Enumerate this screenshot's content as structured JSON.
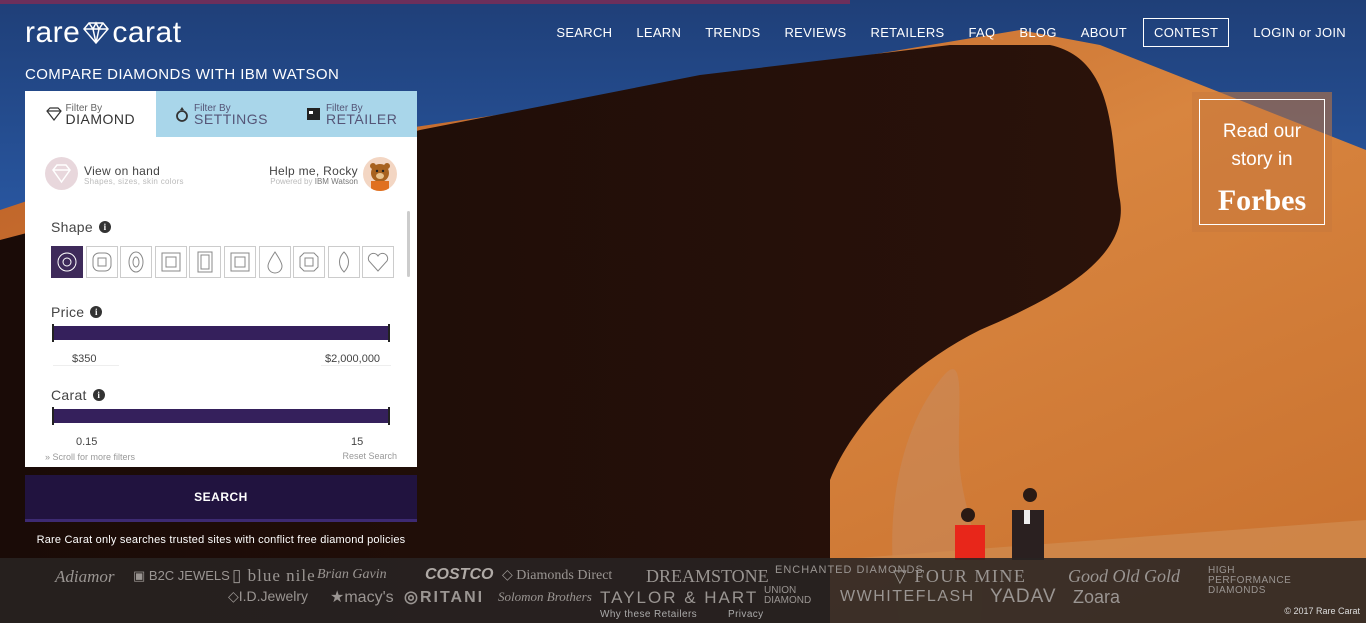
{
  "header": {
    "logo_text_left": "rare",
    "logo_text_right": "carat",
    "tagline": "COMPARE DIAMONDS WITH IBM WATSON",
    "nav": [
      "SEARCH",
      "LEARN",
      "TRENDS",
      "REVIEWS",
      "RETAILERS",
      "FAQ",
      "BLOG",
      "ABOUT",
      "CONTEST",
      "LOGIN or JOIN"
    ]
  },
  "forbes": {
    "line1": "Read our",
    "line2": "story in",
    "logo": "Forbes"
  },
  "panel": {
    "tabs": [
      {
        "small": "Filter By",
        "big": "DIAMOND",
        "icon": "diamond-icon"
      },
      {
        "small": "Filter By",
        "big": "SETTINGS",
        "icon": "ring-icon"
      },
      {
        "small": "Filter By",
        "big": "RETAILER",
        "icon": "store-icon"
      }
    ],
    "view_on_hand": {
      "title": "View on hand",
      "subtitle": "Shapes, sizes, skin colors"
    },
    "rocky": {
      "title": "Help me, Rocky",
      "powered": "Powered by",
      "brand": "IBM Watson"
    },
    "shape_label": "Shape",
    "shapes": [
      "round",
      "cushion",
      "oval",
      "princess",
      "emerald",
      "radiant",
      "pear",
      "asscher",
      "marquise",
      "heart"
    ],
    "price_label": "Price",
    "price_min": "$350",
    "price_max": "$2,000,000",
    "carat_label": "Carat",
    "carat_min": "0.15",
    "carat_max": "15",
    "scroll_more": "Scroll for more filters",
    "reset": "Reset Search"
  },
  "search_button": "SEARCH",
  "trusted_text": "Rare Carat only searches trusted sites with conflict free diamond policies",
  "retailers": [
    "Adiamor",
    "B2C JEWELS",
    "blue nile",
    "Brian Gavin",
    "COSTCO",
    "Diamonds Direct",
    "DREAMSTONE",
    "ENCHANTED DIAMONDS",
    "FOUR MINE",
    "Good Old Gold",
    "HIGH PERFORMANCE DIAMONDS",
    "I.D.Jewelry",
    "macy's",
    "RITANI",
    "Solomon Brothers",
    "TAYLOR & HART",
    "UNION DIAMOND",
    "WHITEFLASH",
    "YADAV",
    "Zoara"
  ],
  "footer_links": {
    "why": "Why these Retailers",
    "privacy": "Privacy"
  },
  "copyright": "© 2017 Rare Carat"
}
